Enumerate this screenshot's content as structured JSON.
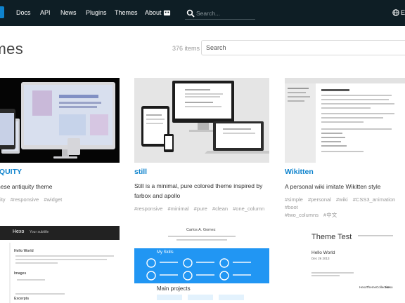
{
  "nav": {
    "links": [
      "Docs",
      "API",
      "News",
      "Plugins",
      "Themes",
      "About"
    ],
    "search_placeholder": "Search...",
    "language_label": "E"
  },
  "header": {
    "title": "emes",
    "count": "376 items",
    "search_placeholder": "Search"
  },
  "themes": [
    {
      "name": "IQUITY",
      "description": "nese antiquity theme",
      "tags": [
        "uity",
        "#responsive",
        "#widget"
      ]
    },
    {
      "name": "still",
      "description": "Still is a minimal, pure colored theme inspired by farbox and apollo",
      "tags": [
        "#responsive",
        "#minimal",
        "#pure",
        "#clean",
        "#one_column"
      ]
    },
    {
      "name": "Wikitten",
      "description": "A personal wiki imitate Wikitten style",
      "tags": [
        "#simple",
        "#personal",
        "#wiki",
        "#CSS3_animation",
        "#boot",
        "#two_columns",
        "#中文"
      ]
    }
  ],
  "previews": {
    "hexo_dark": {
      "brand": "Hexo",
      "subtitle": "Your subtitle",
      "headings": [
        "Hello World",
        "Images",
        "Excerpts"
      ]
    },
    "carlos": {
      "name": "Carlos A. Gomez",
      "section_skills": "My Skills",
      "section_projects": "Main projects"
    },
    "theme_test": {
      "title": "Theme Test",
      "post": "Hello World",
      "date": "Dec 26 2013",
      "links": [
        "Hexo",
        "ThemeCollection",
        "Hexo"
      ]
    }
  }
}
